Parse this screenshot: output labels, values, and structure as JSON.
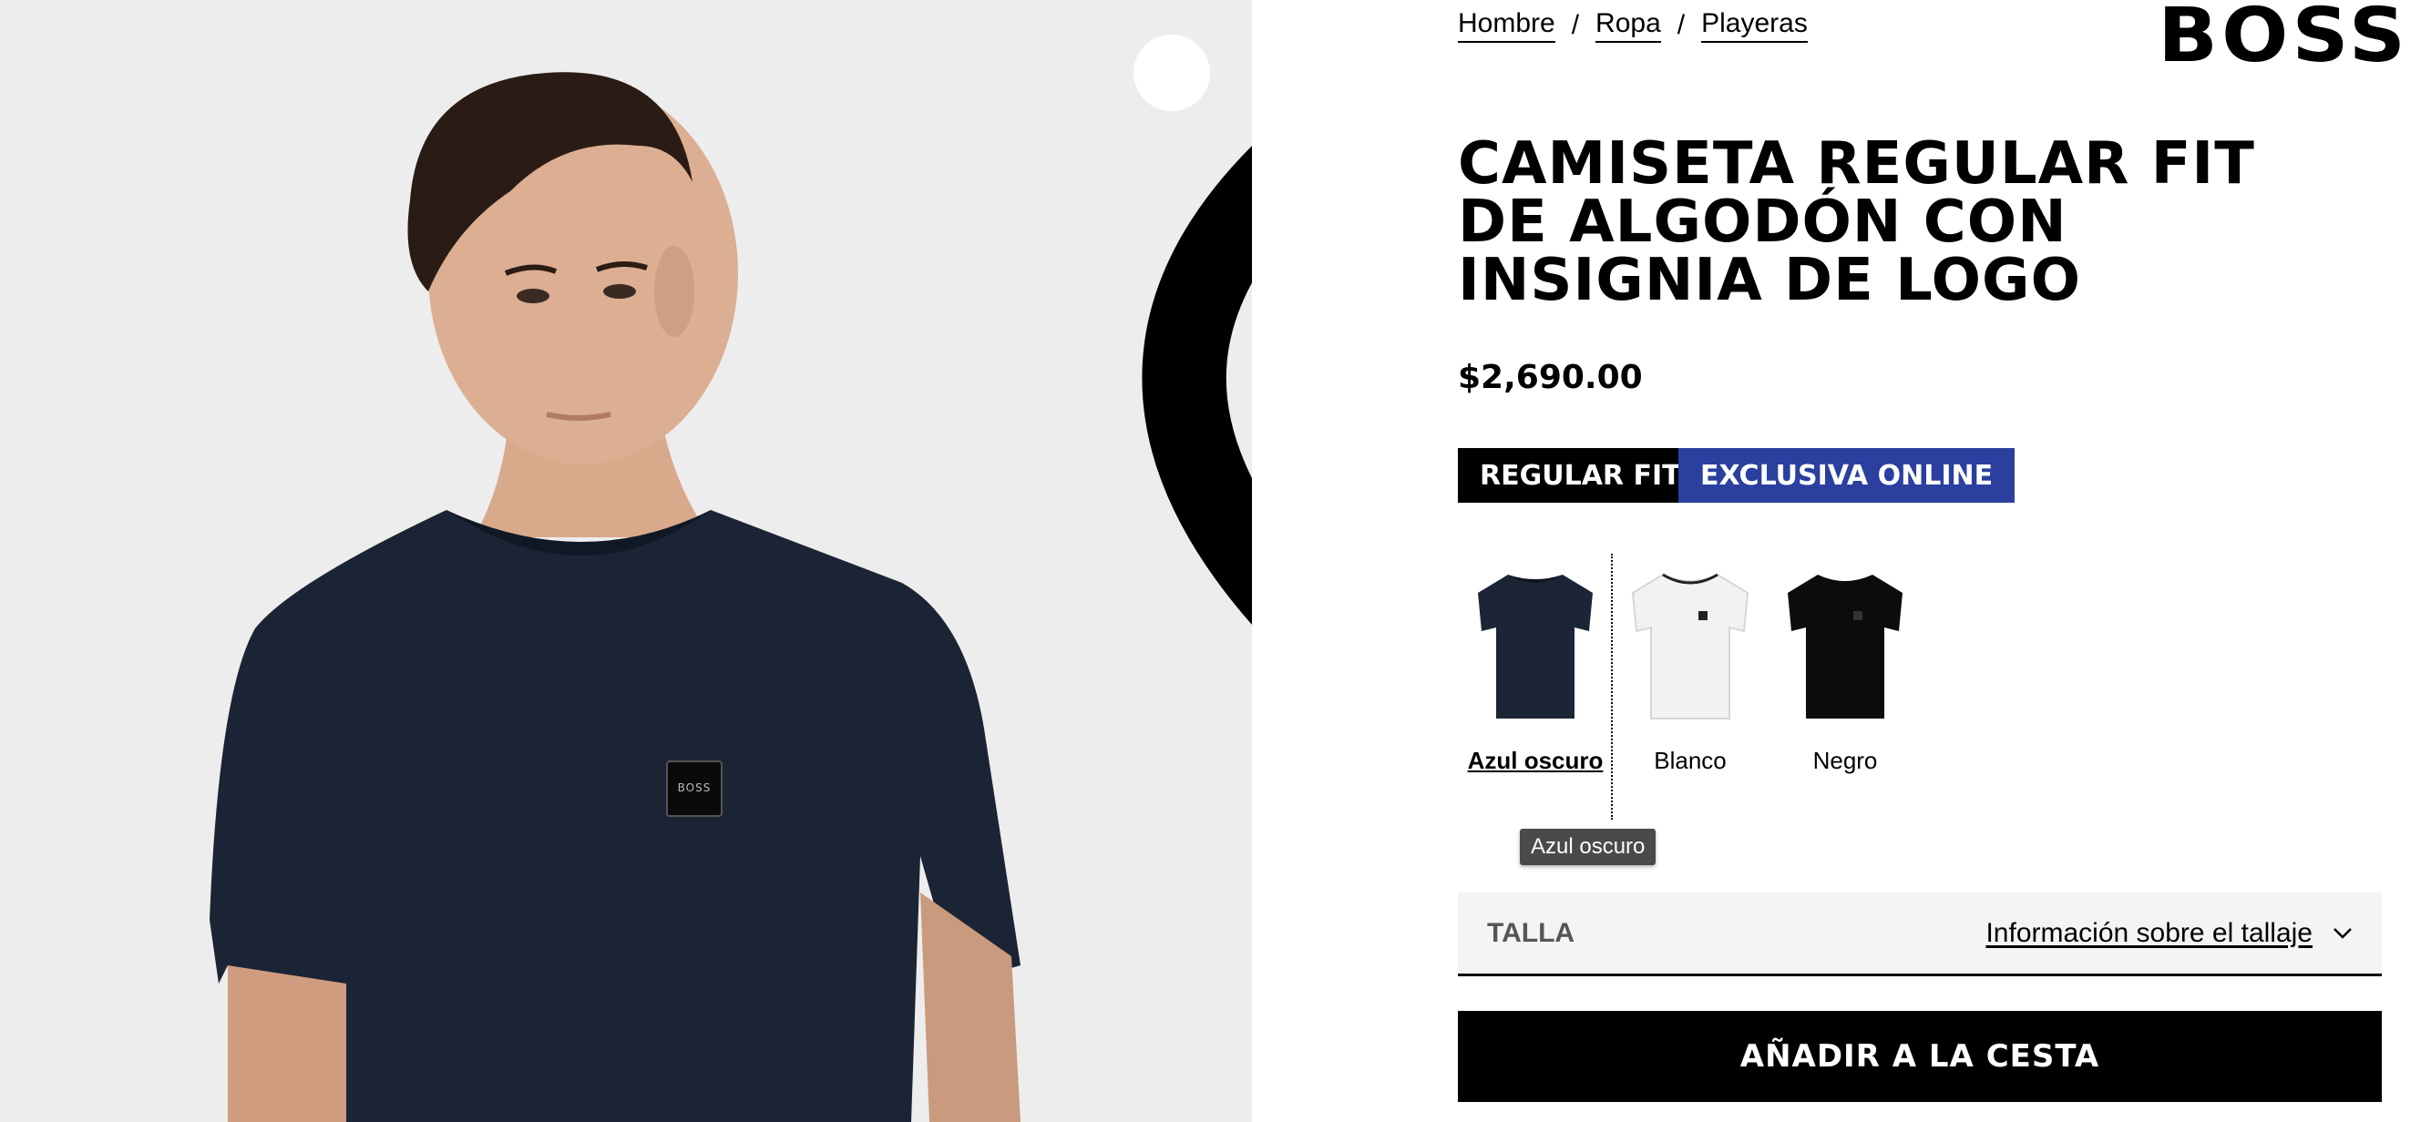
{
  "breadcrumb": [
    "Hombre",
    "Ropa",
    "Playeras"
  ],
  "breadcrumb_separator": "/",
  "brand_logo": "BOSS",
  "product": {
    "title": "CAMISETA REGULAR FIT DE ALGODÓN CON INSIGNIA DE LOGO",
    "price": "$2,690.00",
    "badges": [
      {
        "label": "REGULAR FIT",
        "color": "#000000"
      },
      {
        "label": "EXCLUSIVA ONLINE",
        "color": "#2b3f9e"
      }
    ]
  },
  "colors": [
    {
      "label": "Azul oscuro",
      "swatch": "#1c2536",
      "selected": true
    },
    {
      "label": "Blanco",
      "swatch": "#f2f2f2",
      "selected": false
    },
    {
      "label": "Negro",
      "swatch": "#0c0c0c",
      "selected": false
    }
  ],
  "tooltip": "Azul oscuro",
  "size": {
    "label": "TALLA",
    "info_link": "Información sobre el tallaje"
  },
  "add_to_cart": "AÑADIR A LA CESTA",
  "image_logo_badge": "BOSS",
  "icons": {
    "wishlist": "heart-outline-icon",
    "size_info": "chevron-down-icon"
  }
}
